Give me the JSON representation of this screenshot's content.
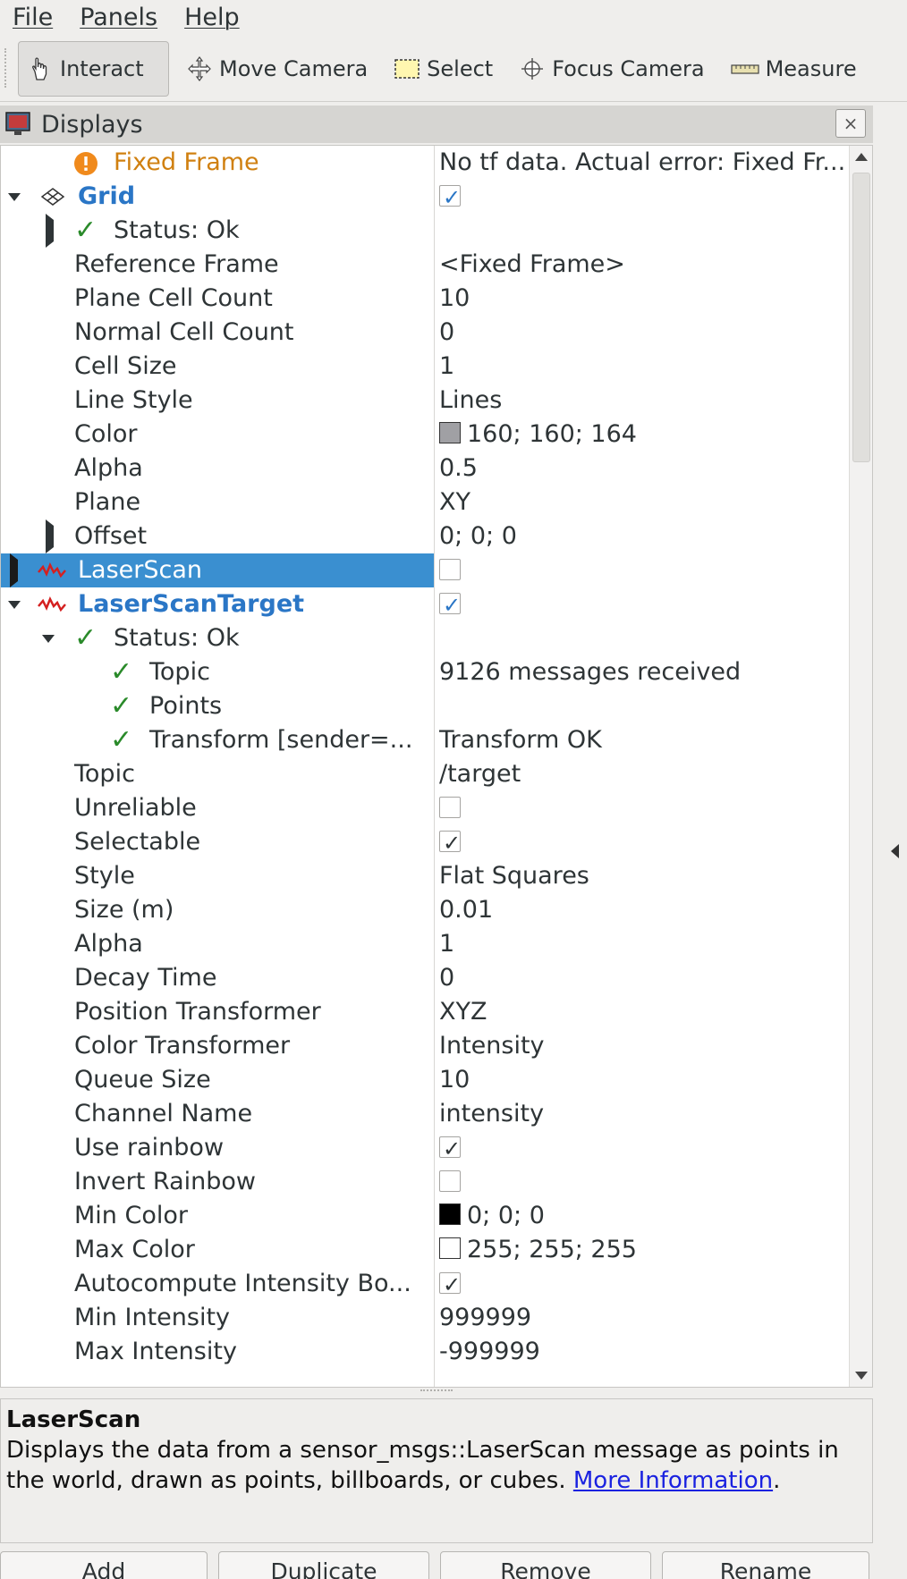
{
  "menubar": {
    "file": "File",
    "panels": "Panels",
    "help": "Help"
  },
  "toolbar": {
    "interact": "Interact",
    "move_camera": "Move Camera",
    "select": "Select",
    "focus_camera": "Focus Camera",
    "measure": "Measure"
  },
  "displays": {
    "title": "Displays",
    "close": "×"
  },
  "rows": [
    {
      "label": "Fixed Frame",
      "value": "No tf data.  Actual error: Fixed Fr..."
    },
    {
      "label": "Grid",
      "value": ""
    },
    {
      "label": "Status: Ok",
      "value": ""
    },
    {
      "label": "Reference Frame",
      "value": "<Fixed Frame>"
    },
    {
      "label": "Plane Cell Count",
      "value": "10"
    },
    {
      "label": "Normal Cell Count",
      "value": "0"
    },
    {
      "label": "Cell Size",
      "value": "1"
    },
    {
      "label": "Line Style",
      "value": "Lines"
    },
    {
      "label": "Color",
      "value": "160; 160; 164"
    },
    {
      "label": "Alpha",
      "value": "0.5"
    },
    {
      "label": "Plane",
      "value": "XY"
    },
    {
      "label": "Offset",
      "value": "0; 0; 0"
    },
    {
      "label": "LaserScan",
      "value": ""
    },
    {
      "label": "LaserScanTarget",
      "value": ""
    },
    {
      "label": "Status: Ok",
      "value": ""
    },
    {
      "label": "Topic",
      "value": "9126 messages received"
    },
    {
      "label": "Points",
      "value": ""
    },
    {
      "label": "Transform [sender=...",
      "value": "Transform OK"
    },
    {
      "label": "Topic",
      "value": "/target"
    },
    {
      "label": "Unreliable",
      "value": ""
    },
    {
      "label": "Selectable",
      "value": ""
    },
    {
      "label": "Style",
      "value": "Flat Squares"
    },
    {
      "label": "Size (m)",
      "value": "0.01"
    },
    {
      "label": "Alpha",
      "value": "1"
    },
    {
      "label": "Decay Time",
      "value": "0"
    },
    {
      "label": "Position Transformer",
      "value": "XYZ"
    },
    {
      "label": "Color Transformer",
      "value": "Intensity"
    },
    {
      "label": "Queue Size",
      "value": "10"
    },
    {
      "label": "Channel Name",
      "value": "intensity"
    },
    {
      "label": "Use rainbow",
      "value": ""
    },
    {
      "label": "Invert Rainbow",
      "value": ""
    },
    {
      "label": "Min Color",
      "value": "0; 0; 0"
    },
    {
      "label": "Max Color",
      "value": "255; 255; 255"
    },
    {
      "label": "Autocompute Intensity Bo...",
      "value": ""
    },
    {
      "label": "Min Intensity",
      "value": "999999"
    },
    {
      "label": "Max Intensity",
      "value": "-999999"
    }
  ],
  "colors": {
    "grid_color": "#a0a0a4",
    "min_color": "#000000",
    "max_color": "#ffffff",
    "selection": "#3a8fd0",
    "status_ok": "#2a8a2a",
    "warning": "#d08010"
  },
  "description": {
    "title": "LaserScan",
    "text": "Displays the data from a sensor_msgs::LaserScan message as points in the world, drawn as points, billboards, or cubes.",
    "link": "More Information"
  },
  "buttons": {
    "add": "Add",
    "duplicate": "Duplicate",
    "remove": "Remove",
    "rename": "Rename"
  }
}
